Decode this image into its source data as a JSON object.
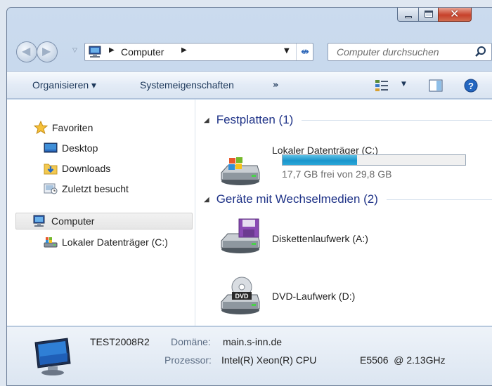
{
  "window": {
    "controls": {
      "minimize": "minimize",
      "maximize": "maximize",
      "close": "✕"
    }
  },
  "navigation": {
    "address_segments": [
      "Computer"
    ],
    "search_placeholder": "Computer durchsuchen"
  },
  "toolbar": {
    "organize_label": "Organisieren ▾",
    "system_properties_label": "Systemeigenschaften",
    "more_label": "»"
  },
  "sidebar": {
    "favorites": {
      "header": "Favoriten",
      "items": [
        {
          "label": "Desktop",
          "icon": "desktop-icon"
        },
        {
          "label": "Downloads",
          "icon": "downloads-folder-icon"
        },
        {
          "label": "Zuletzt besucht",
          "icon": "recent-places-icon"
        }
      ]
    },
    "computer": {
      "label": "Computer",
      "children": [
        {
          "label": "Lokaler Datenträger (C:)",
          "icon": "local-disk-icon"
        }
      ]
    }
  },
  "groups": [
    {
      "title": "Festplatten (1)",
      "items": [
        {
          "name": "Lokaler Datenträger (C:)",
          "free_text": "17,7 GB frei von 29,8 GB",
          "used_fraction": 0.406
        }
      ]
    },
    {
      "title": "Geräte mit Wechselmedien (2)",
      "items": [
        {
          "name": "Diskettenlaufwerk (A:)"
        },
        {
          "name": "DVD-Laufwerk (D:)"
        }
      ]
    }
  ],
  "details": {
    "computer_name": "TEST2008R2",
    "domain_label": "Domäne:",
    "domain_value": "main.s-inn.de",
    "processor_label": "Prozessor:",
    "processor_value": "Intel(R) Xeon(R) CPU",
    "processor_model": "E5506  @ 2.13GHz"
  },
  "colors": {
    "accent": "#1e3287",
    "bar_fill": "#1a95cc"
  }
}
